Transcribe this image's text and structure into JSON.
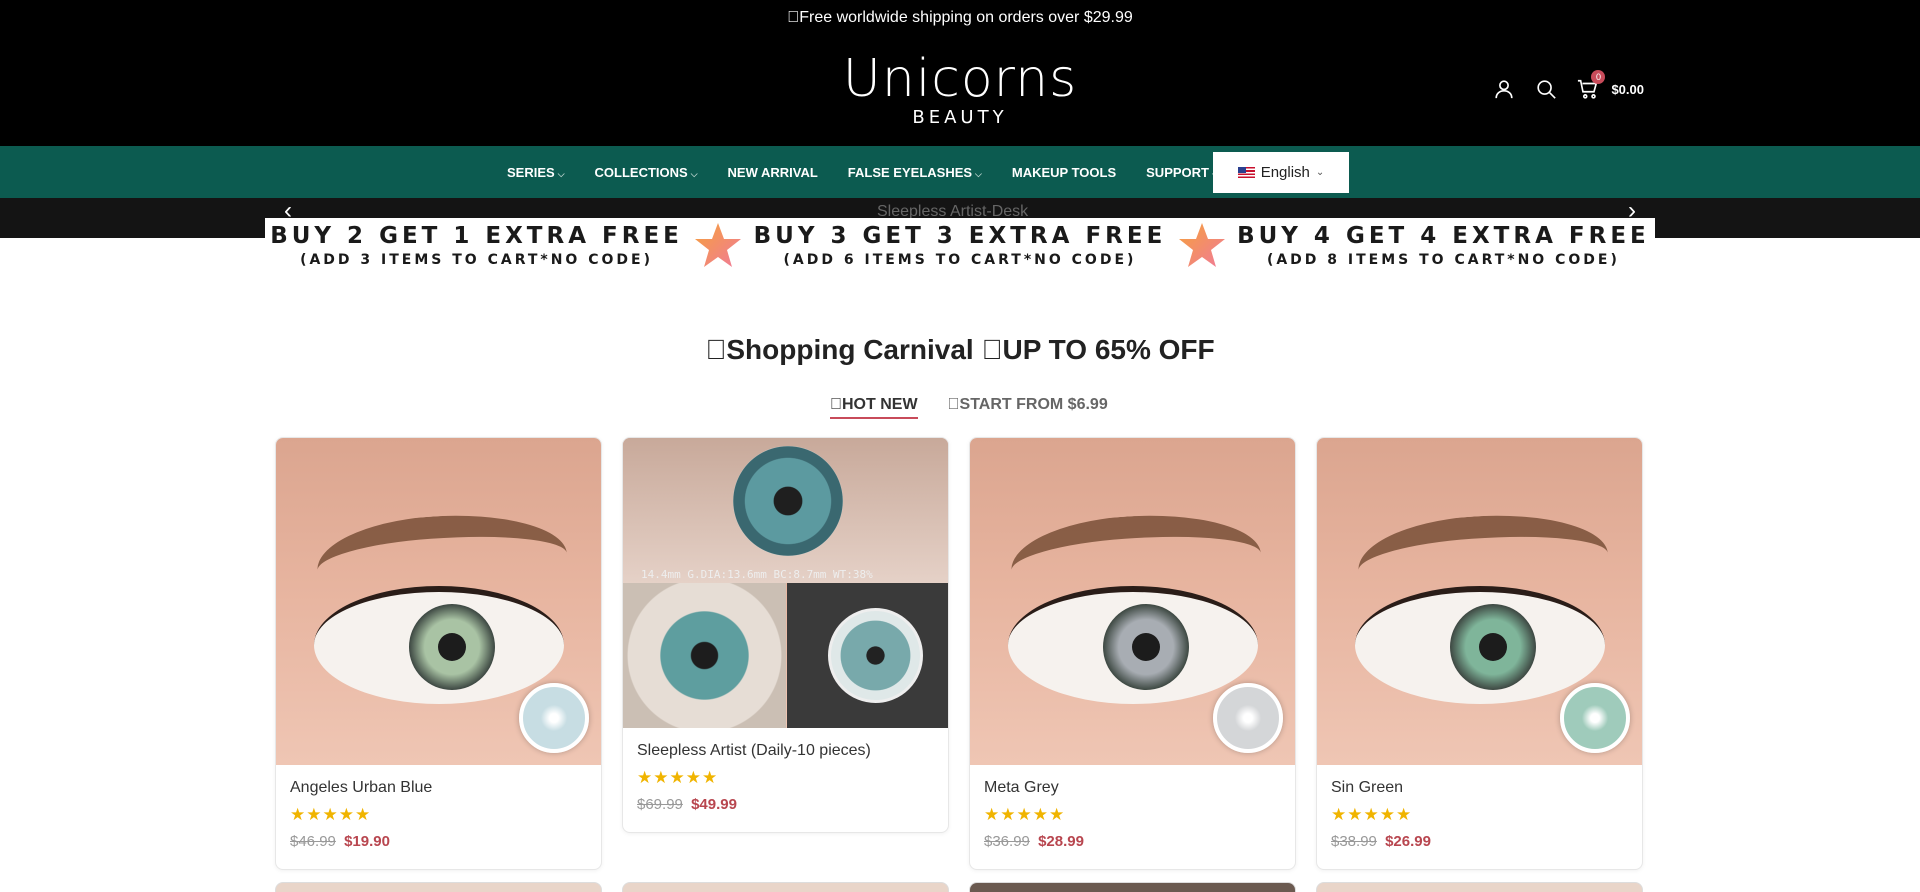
{
  "announcement": "Free worldwide shipping on orders over $29.99",
  "logo": {
    "main": "Unicorns",
    "sub": "BEAUTY"
  },
  "header": {
    "cart_count": "0",
    "cart_total": "$0.00"
  },
  "nav": {
    "items": [
      {
        "label": "SERIES",
        "has_dropdown": true
      },
      {
        "label": "COLLECTIONS",
        "has_dropdown": true
      },
      {
        "label": "NEW ARRIVAL",
        "has_dropdown": false
      },
      {
        "label": "FALSE EYELASHES",
        "has_dropdown": true
      },
      {
        "label": "MAKEUP TOOLS",
        "has_dropdown": false
      },
      {
        "label": "SUPPORT",
        "has_dropdown": true
      }
    ],
    "language": "English"
  },
  "slider": {
    "broken_image_alt": "Sleepless Artist-Desk"
  },
  "promo": {
    "deals": [
      {
        "headline": "BUY 2 GET 1 EXTRA FREE",
        "detail": "(ADD 3 ITEMS TO CART*NO CODE)"
      },
      {
        "headline": "BUY 3 GET 3 EXTRA FREE",
        "detail": "(ADD 6 ITEMS TO CART*NO CODE)"
      },
      {
        "headline": "BUY 4 GET 4 EXTRA FREE",
        "detail": "(ADD 8 ITEMS TO CART*NO CODE)"
      }
    ]
  },
  "section": {
    "title": "Shopping Carnival UP TO 65% OFF",
    "tabs": [
      {
        "label": "HOT NEW",
        "active": true
      },
      {
        "label": "START FROM $6.99",
        "active": false
      }
    ]
  },
  "products": [
    {
      "name": "Angeles Urban Blue",
      "rating": 5,
      "stars": "★★★★★",
      "old_price": "$46.99",
      "price": "$19.90",
      "iris_color": "#a9c3a4",
      "lens_color": "#c7dde3"
    },
    {
      "name": "Sleepless Artist (Daily-10 pieces)",
      "rating": 5,
      "stars": "★★★★★",
      "old_price": "$69.99",
      "price": "$49.99",
      "iris_color": "#5c9aa0",
      "lens_color": "#78a9ab",
      "spec_text": "14.4mm G.DIA:13.6mm BC:8.7mm WT:38%"
    },
    {
      "name": "Meta Grey",
      "rating": 5,
      "stars": "★★★★★",
      "old_price": "$36.99",
      "price": "$28.99",
      "iris_color": "#a8adb3",
      "lens_color": "#d4d6d8"
    },
    {
      "name": "Sin Green",
      "rating": 5,
      "stars": "★★★★★",
      "old_price": "$38.99",
      "price": "$26.99",
      "iris_color": "#7fb59a",
      "lens_color": "#9fcbbb"
    }
  ],
  "colors": {
    "nav_bg": "#0c5b50",
    "accent": "#c84b5a",
    "sale_price": "#b8464f",
    "star": "#f0b400"
  }
}
